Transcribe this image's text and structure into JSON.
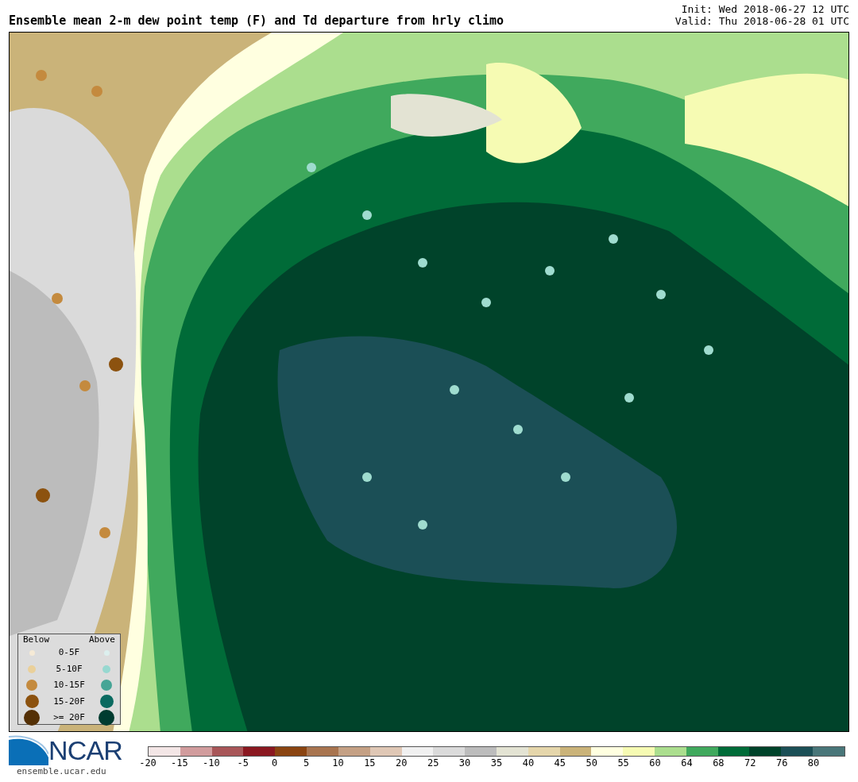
{
  "title": "Ensemble mean 2-m dew point temp (F) and Td departure from hrly climo",
  "init": "Init: Wed 2018-06-27 12 UTC",
  "valid": "Valid: Thu 2018-06-28 01 UTC",
  "legend": {
    "below_header": "Below",
    "above_header": "Above",
    "rows": [
      {
        "label": "0-5F",
        "below": {
          "color": "#f5ead6"
        },
        "above": {
          "color": "#dcefee"
        }
      },
      {
        "label": "5-10F",
        "below": {
          "color": "#ead09a"
        },
        "above": {
          "color": "#97d8d0"
        }
      },
      {
        "label": "10-15F",
        "below": {
          "color": "#c48a3e"
        },
        "above": {
          "color": "#46a596"
        }
      },
      {
        "label": "15-20F",
        "below": {
          "color": "#8c520f"
        },
        "above": {
          "color": "#0a6a60"
        }
      },
      {
        "label": ">= 20F",
        "below": {
          "color": "#543005"
        },
        "above": {
          "color": "#003c30"
        }
      }
    ]
  },
  "colorbar": {
    "bins": [
      {
        "color": "#f3e6e6"
      },
      {
        "color": "#d19c9d"
      },
      {
        "color": "#a85658"
      },
      {
        "color": "#8a1820"
      },
      {
        "color": "#8a4411"
      },
      {
        "color": "#a8744f"
      },
      {
        "color": "#c4a084"
      },
      {
        "color": "#dfc7b5"
      },
      {
        "color": "#f0f0f0"
      },
      {
        "color": "#dadada"
      },
      {
        "color": "#bcbcbc"
      },
      {
        "color": "#e3e3d3"
      },
      {
        "color": "#e5d6ab"
      },
      {
        "color": "#cab379"
      },
      {
        "color": "#ffffe0"
      },
      {
        "color": "#f6fbb3"
      },
      {
        "color": "#abde8e"
      },
      {
        "color": "#40a95d"
      },
      {
        "color": "#006b38"
      },
      {
        "color": "#00432a"
      },
      {
        "color": "#1b4f56"
      },
      {
        "color": "#497679"
      }
    ],
    "ticks": [
      "-20",
      "-15",
      "-10",
      "-5",
      "0",
      "5",
      "10",
      "15",
      "20",
      "25",
      "30",
      "35",
      "40",
      "45",
      "50",
      "55",
      "60",
      "64",
      "68",
      "72",
      "76",
      "80"
    ]
  },
  "logo": {
    "text": "NCAR",
    "url": "ensemble.ucar.edu"
  }
}
